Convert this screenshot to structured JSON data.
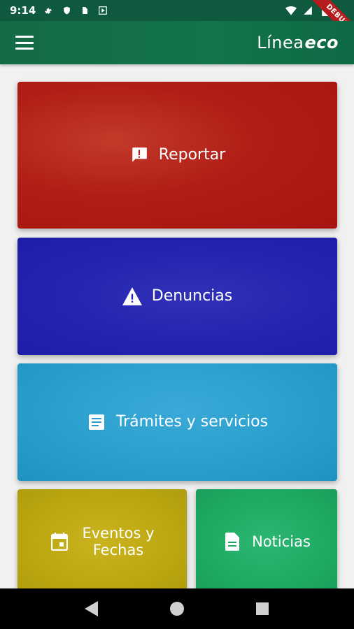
{
  "status_bar": {
    "time": "9:14",
    "debug_label": "DEBUG",
    "icons": [
      "gear-icon",
      "shield-icon",
      "sim-card-icon",
      "play-icon",
      "wifi-icon",
      "signal-icon",
      "battery-icon"
    ]
  },
  "app_bar": {
    "logo_text": "Línea",
    "logo_accent": "eco",
    "menu_icon": "hamburger-menu-icon"
  },
  "tiles": {
    "reportar": {
      "label": "Reportar",
      "icon": "report-bubble-icon",
      "color": "#b01d16"
    },
    "denuncias": {
      "label": "Denuncias",
      "icon": "warning-icon",
      "color": "#2424b0"
    },
    "tramites": {
      "label": "Trámites y servicios",
      "icon": "document-list-icon",
      "color": "#2a9fcd"
    },
    "eventos": {
      "label_line1": "Eventos y",
      "label_line2": "Fechas",
      "icon": "calendar-icon",
      "color": "#bca710"
    },
    "noticias": {
      "label": "Noticias",
      "icon": "news-file-icon",
      "color": "#1faa63"
    }
  },
  "nav_bar": {
    "back_icon": "back-triangle-icon",
    "home_icon": "home-circle-icon",
    "recents_icon": "recents-square-icon"
  }
}
